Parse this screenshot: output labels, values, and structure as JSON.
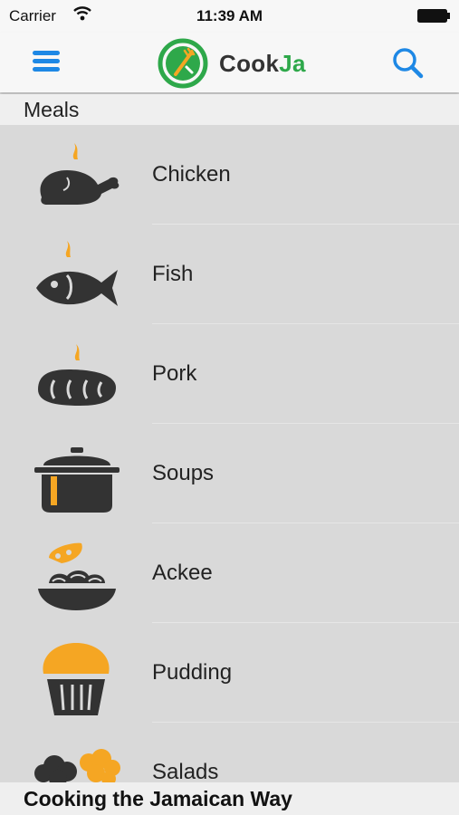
{
  "status_bar": {
    "carrier": "Carrier",
    "time": "11:39 AM"
  },
  "nav": {
    "logo_part1": "Cook",
    "logo_part2": "Ja",
    "menu_icon": "hamburger-menu-icon",
    "search_icon": "search-icon"
  },
  "section": {
    "title": "Meals"
  },
  "meals": [
    {
      "label": "Chicken",
      "icon": "roast-chicken-icon"
    },
    {
      "label": "Fish",
      "icon": "fish-icon"
    },
    {
      "label": "Pork",
      "icon": "pork-icon"
    },
    {
      "label": "Soups",
      "icon": "soup-pot-icon"
    },
    {
      "label": "Ackee",
      "icon": "ackee-bowl-icon"
    },
    {
      "label": "Pudding",
      "icon": "pudding-cupcake-icon"
    },
    {
      "label": "Salads",
      "icon": "salad-icon"
    }
  ],
  "footer": {
    "text": "Cooking the Jamaican Way"
  },
  "colors": {
    "accent_blue": "#1e88e5",
    "brand_green": "#2ea84a",
    "icon_dark": "#333333",
    "icon_orange": "#f5a623"
  }
}
